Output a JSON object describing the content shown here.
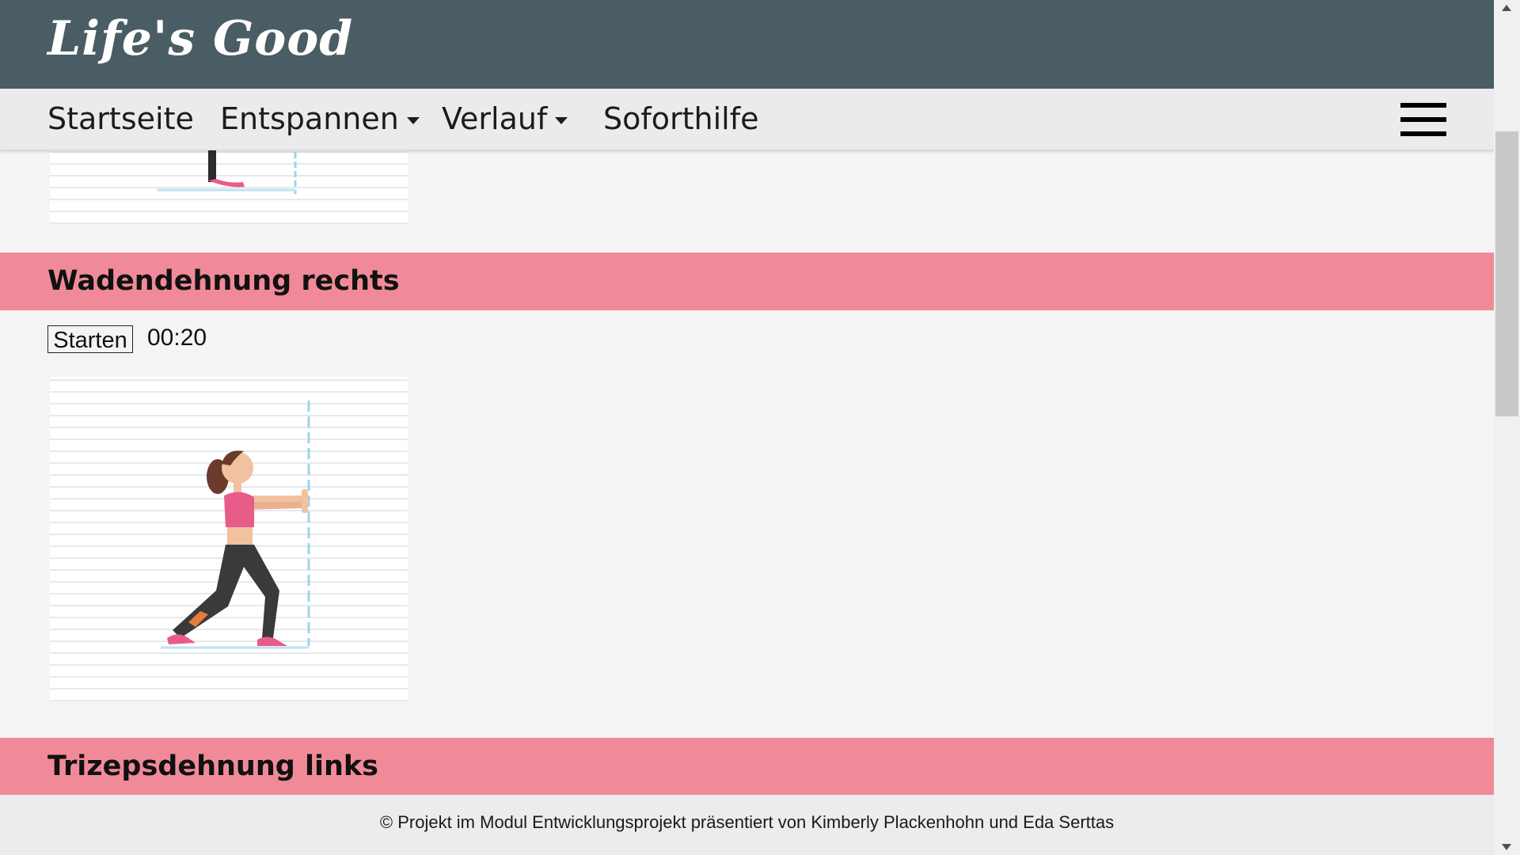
{
  "brand": {
    "title": "Life's Good"
  },
  "nav": {
    "items": [
      {
        "label": "Startseite",
        "has_dropdown": false
      },
      {
        "label": "Entspannen",
        "has_dropdown": true
      },
      {
        "label": "Verlauf",
        "has_dropdown": true
      },
      {
        "label": "Soforthilfe",
        "has_dropdown": false
      }
    ],
    "menu_icon": "hamburger-icon"
  },
  "sections": [
    {
      "title": "Wadendehnung rechts",
      "start_label": "Starten",
      "timer": "00:20",
      "image_icon": "calf-stretch-illustration"
    },
    {
      "title": "Trizepsdehnung links"
    }
  ],
  "footer": {
    "text": "© Projekt im Modul Entwicklungsprojekt präsentiert von Kimberly Plackenhohn und Eda Serttas"
  },
  "colors": {
    "header_bg": "#4a5c64",
    "nav_bg": "#ebebeb",
    "section_bg": "#f18a98",
    "page_bg": "#f4f4f4"
  }
}
